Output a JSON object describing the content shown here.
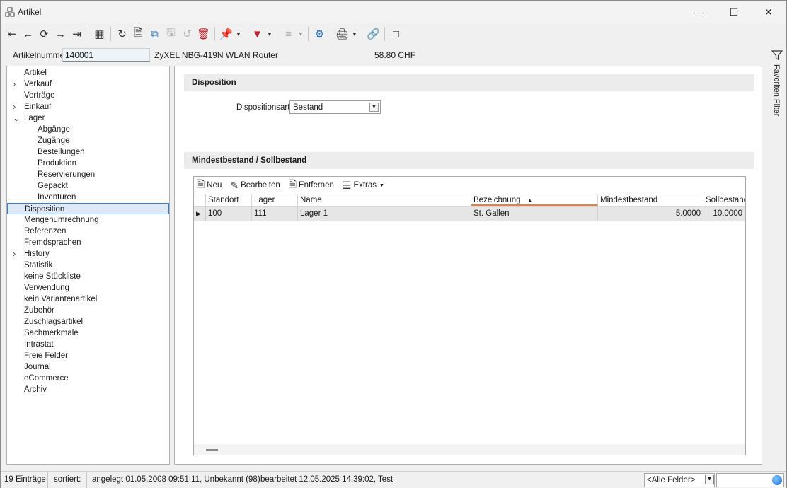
{
  "window": {
    "title": "Artikel"
  },
  "toolbar": {
    "icons": [
      "first-icon",
      "prev-icon",
      "history-icon",
      "next-icon",
      "last-icon",
      "table-icon",
      "refresh-icon",
      "new-doc-icon",
      "copy-icon",
      "save-icon",
      "undo-icon",
      "delete-icon",
      "pin-icon",
      "filter-icon",
      "tree-icon",
      "settings-icon",
      "print-icon",
      "link-icon",
      "layout-icon"
    ]
  },
  "article": {
    "number_label": "Artikelnummer",
    "number_value": "140001",
    "description": "ZyXEL NBG-419N WLAN Router",
    "price": "58.80  CHF"
  },
  "favorites": {
    "label": "Favoriten Filter"
  },
  "tree": {
    "items": [
      {
        "label": "Artikel",
        "level": 0,
        "toggle": ""
      },
      {
        "label": "Verkauf",
        "level": 0,
        "toggle": ">"
      },
      {
        "label": "Verträge",
        "level": 0,
        "toggle": ""
      },
      {
        "label": "Einkauf",
        "level": 0,
        "toggle": ">"
      },
      {
        "label": "Lager",
        "level": 0,
        "toggle": "v"
      },
      {
        "label": "Abgänge",
        "level": 1,
        "toggle": ""
      },
      {
        "label": "Zugänge",
        "level": 1,
        "toggle": ""
      },
      {
        "label": "Bestellungen",
        "level": 1,
        "toggle": ""
      },
      {
        "label": "Produktion",
        "level": 1,
        "toggle": ""
      },
      {
        "label": "Reservierungen",
        "level": 1,
        "toggle": ""
      },
      {
        "label": "Gepackt",
        "level": 1,
        "toggle": ""
      },
      {
        "label": "Inventuren",
        "level": 1,
        "toggle": ""
      },
      {
        "label": "Disposition",
        "level": 0,
        "toggle": "",
        "selected": true
      },
      {
        "label": "Mengenumrechnung",
        "level": 0,
        "toggle": ""
      },
      {
        "label": "Referenzen",
        "level": 0,
        "toggle": ""
      },
      {
        "label": "Fremdsprachen",
        "level": 0,
        "toggle": ""
      },
      {
        "label": "History",
        "level": 0,
        "toggle": ">"
      },
      {
        "label": "Statistik",
        "level": 0,
        "toggle": ""
      },
      {
        "label": "keine Stückliste",
        "level": 0,
        "toggle": ""
      },
      {
        "label": "Verwendung",
        "level": 0,
        "toggle": ""
      },
      {
        "label": "kein Variantenartikel",
        "level": 0,
        "toggle": ""
      },
      {
        "label": "Zubehör",
        "level": 0,
        "toggle": ""
      },
      {
        "label": "Zuschlagsartikel",
        "level": 0,
        "toggle": ""
      },
      {
        "label": "Sachmerkmale",
        "level": 0,
        "toggle": ""
      },
      {
        "label": "Intrastat",
        "level": 0,
        "toggle": ""
      },
      {
        "label": "Freie Felder",
        "level": 0,
        "toggle": ""
      },
      {
        "label": "Journal",
        "level": 0,
        "toggle": ""
      },
      {
        "label": "eCommerce",
        "level": 0,
        "toggle": ""
      },
      {
        "label": "Archiv",
        "level": 0,
        "toggle": ""
      }
    ]
  },
  "disposition": {
    "section_title": "Disposition",
    "type_label": "Dispositionsart",
    "type_value": "Bestand"
  },
  "stock": {
    "section_title": "Mindestbestand / Sollbestand",
    "tools": {
      "new": "Neu",
      "edit": "Bearbeiten",
      "remove": "Entfernen",
      "extras": "Extras"
    },
    "columns": [
      "Standort",
      "Lager",
      "Name",
      "Bezeichnung",
      "Mindestbestand",
      "Sollbestand"
    ],
    "sorted_column": "Bezeichnung",
    "rows": [
      {
        "standort": "100",
        "lager": "111",
        "name": "Lager 1",
        "bezeichnung": "St. Gallen",
        "mindest": "5.0000",
        "soll": "10.0000"
      }
    ]
  },
  "status": {
    "count": "19 Einträge",
    "sorted": "sortiert:",
    "created": "angelegt 01.05.2008 09:51:11, Unbekannt (98)",
    "edited": "bearbeitet 12.05.2025 14:39:02, Test",
    "field_select": "<Alle Felder>"
  }
}
